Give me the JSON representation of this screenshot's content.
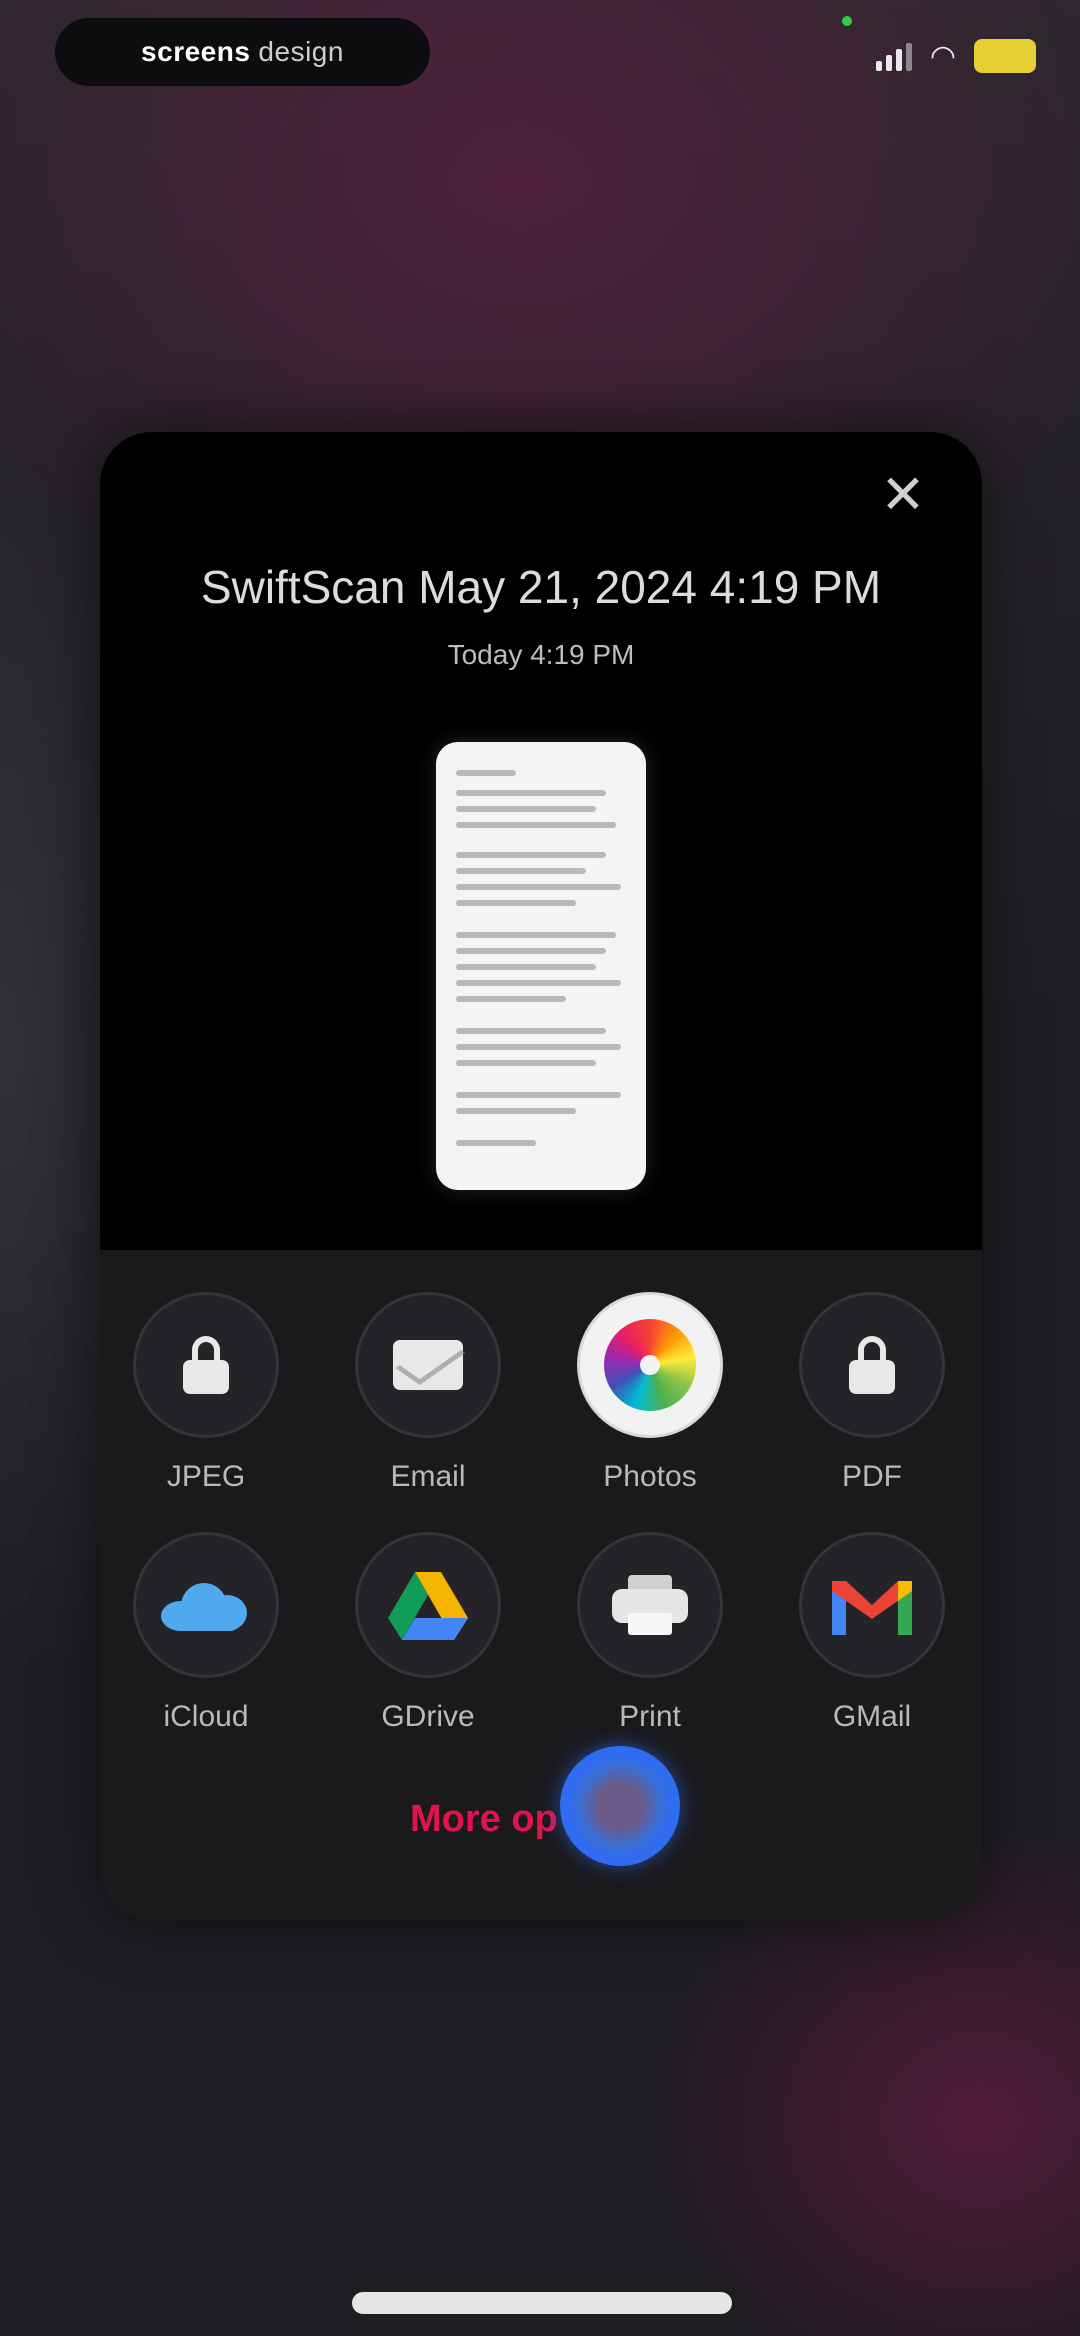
{
  "status_bar": {
    "recording_pill": {
      "brand": "screens",
      "suffix": "design"
    },
    "battery_label": ""
  },
  "share_sheet": {
    "close_glyph": "✕",
    "title": "SwiftScan May 21, 2024 4:19 PM",
    "subtitle": "Today 4:19 PM",
    "actions": [
      {
        "label": "JPEG",
        "icon": "lock-icon"
      },
      {
        "label": "Email",
        "icon": "envelope-icon"
      },
      {
        "label": "Photos",
        "icon": "photos-icon"
      },
      {
        "label": "PDF",
        "icon": "lock-icon"
      },
      {
        "label": "iCloud",
        "icon": "icloud-icon"
      },
      {
        "label": "GDrive",
        "icon": "google-drive-icon"
      },
      {
        "label": "Print",
        "icon": "printer-icon"
      },
      {
        "label": "GMail",
        "icon": "gmail-icon"
      }
    ],
    "more_label": "More op",
    "colors": {
      "accent": "#e0134e",
      "touch_indicator": "#2f6cf0"
    }
  }
}
